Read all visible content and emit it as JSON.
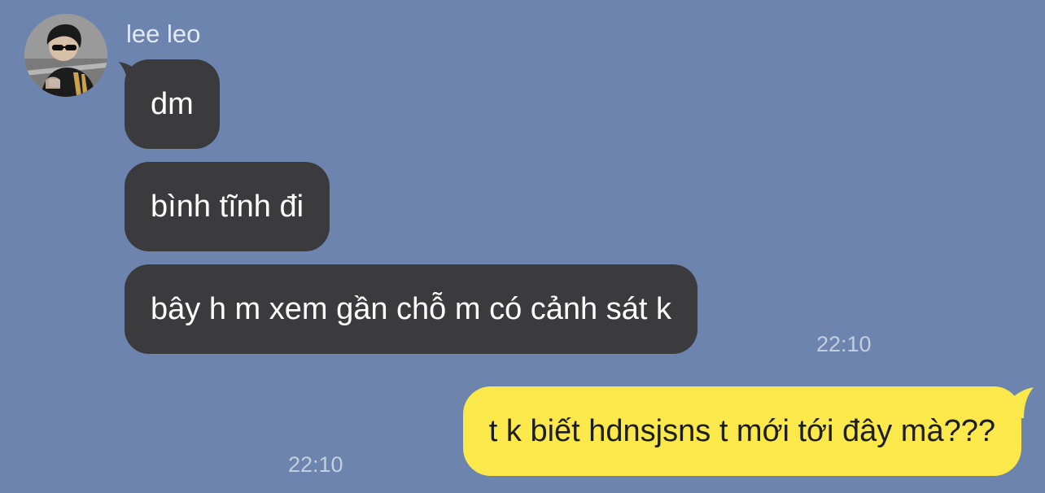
{
  "chat": {
    "incoming": {
      "sender_name": "lee leo",
      "messages": [
        {
          "text": "dm"
        },
        {
          "text": "bình tĩnh đi"
        },
        {
          "text": "bây h m xem gần chỗ m có cảnh sát k"
        }
      ],
      "time": "22:10"
    },
    "outgoing": {
      "messages": [
        {
          "text": "t k biết hdnsjsns t mới tới đây mà???"
        }
      ],
      "time": "22:10"
    }
  },
  "colors": {
    "background": "#6c84ae",
    "incoming_bubble": "#3b3b3e",
    "outgoing_bubble": "#fbe84b"
  },
  "icons": {
    "avatar": "profile-photo"
  }
}
